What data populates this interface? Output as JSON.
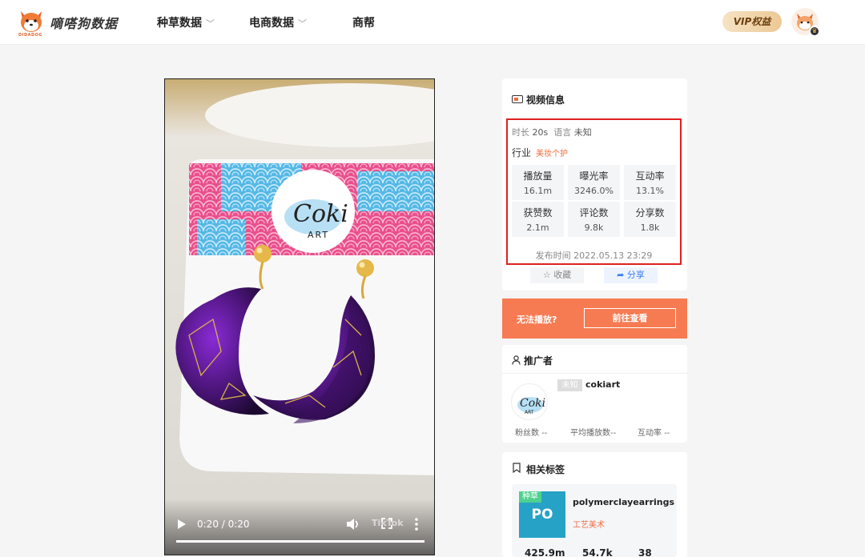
{
  "app": {
    "logo_text": "嘀嗒狗数据",
    "logo_sub": "DIDADOG"
  },
  "nav": {
    "items": [
      {
        "label": "种草数据",
        "has_dropdown": true
      },
      {
        "label": "电商数据",
        "has_dropdown": true
      },
      {
        "label": "商帮",
        "has_dropdown": false
      }
    ],
    "vip_label": "VIP权益"
  },
  "video": {
    "time": "0:20 / 0:20",
    "progress_fraction": 1.0,
    "watermark": "TikTok",
    "card_brand_line1": "Coki",
    "card_brand_line2": "ART"
  },
  "video_info": {
    "title": "视频信息",
    "duration_label": "时长",
    "duration_value": "20s",
    "language_label": "语言",
    "language_value": "未知",
    "industry_label": "行业",
    "industry_value": "美妆个护",
    "stats": [
      {
        "label": "播放量",
        "value": "16.1m"
      },
      {
        "label": "曝光率",
        "value": "3246.0%"
      },
      {
        "label": "互动率",
        "value": "13.1%"
      },
      {
        "label": "获赞数",
        "value": "2.1m"
      },
      {
        "label": "评论数",
        "value": "9.8k"
      },
      {
        "label": "分享数",
        "value": "1.8k"
      }
    ],
    "publish_label": "发布时间",
    "publish_value": "2022.05.13 23:29",
    "fav_label": "收藏",
    "share_label": "分享"
  },
  "cannot_play": {
    "text": "无法播放?",
    "button": "前往查看"
  },
  "promoter": {
    "title": "推广者",
    "tag": "未知",
    "name": "cokiart",
    "fans_label": "粉丝数",
    "fans_value": "--",
    "avg_play_label": "平均播放数",
    "avg_play_value": "--",
    "interaction_label": "互动率",
    "interaction_value": "--"
  },
  "related_tags": {
    "title": "相关标签",
    "items": [
      {
        "ribbon": "种草",
        "abbr": "PO",
        "name": "polymerclayearrings",
        "category": "工艺美术",
        "stats": [
          "425.9m",
          "54.7k",
          "38"
        ]
      }
    ]
  },
  "colors": {
    "accent_orange": "#f77b52",
    "highlight_red": "#e02020",
    "tag_orange": "#f16a3c",
    "po_blue": "#26a2c6",
    "ribbon_green": "#4fd18f",
    "share_blue": "#3b7cf5"
  }
}
